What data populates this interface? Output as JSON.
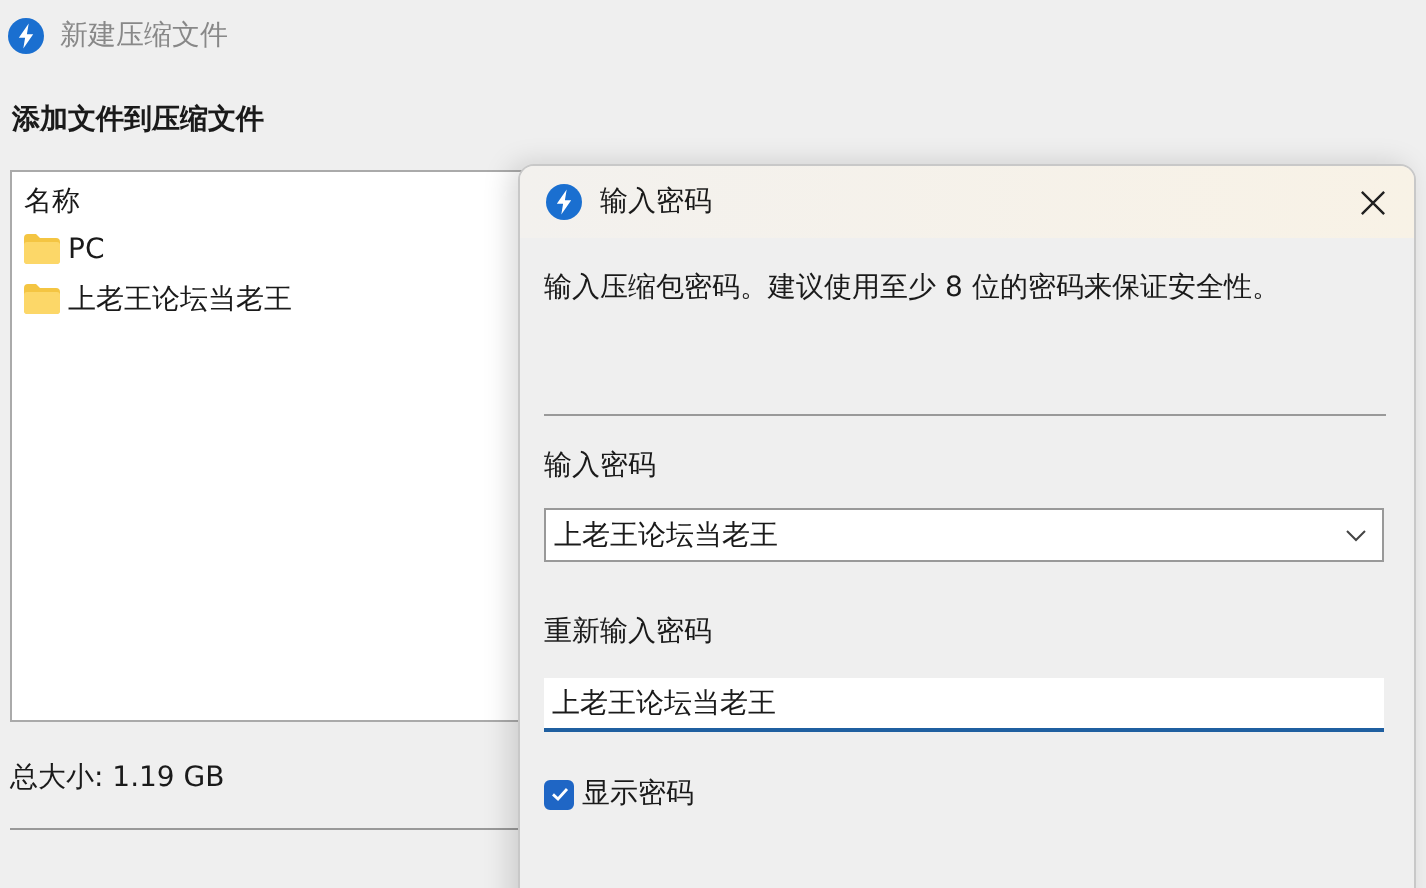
{
  "main_window": {
    "title": "新建压缩文件",
    "heading": "添加文件到压缩文件",
    "file_list": {
      "column": "名称",
      "items": [
        {
          "name": "PC"
        },
        {
          "name": "上老王论坛当老王"
        }
      ]
    },
    "total_size": "总大小: 1.19 GB"
  },
  "dialog": {
    "title": "输入密码",
    "description": "输入压缩包密码。建议使用至少 8 位的密码来保证安全性。",
    "password_label": "输入密码",
    "password_value": "上老王论坛当老王",
    "confirm_label": "重新输入密码",
    "confirm_value": "上老王论坛当老王",
    "show_password": {
      "label": "显示密码",
      "checked": true
    }
  }
}
